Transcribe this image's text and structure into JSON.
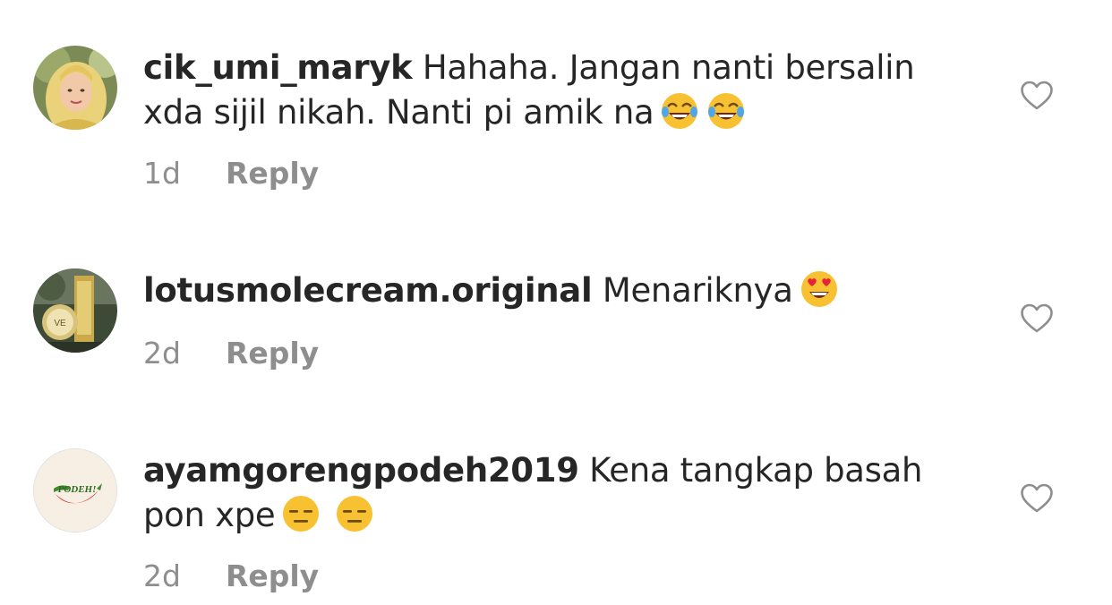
{
  "comments": [
    {
      "username": "cik_umi_maryk",
      "text_line1": " Hahaha. Jangan nanti bersalin",
      "text_line2": "xda sijil nikah. Nanti pi amik na",
      "emojis": [
        "face-with-tears-of-joy-emoji",
        "face-with-tears-of-joy-emoji"
      ],
      "time": "1d",
      "reply_label": "Reply",
      "avatar": "woman-hijab-avatar"
    },
    {
      "username": "lotusmolecream.original",
      "text_line1": " Menariknya",
      "emojis": [
        "heart-eyes-emoji"
      ],
      "time": "2d",
      "reply_label": "Reply",
      "avatar": "cream-product-avatar"
    },
    {
      "username": "ayamgorengpodeh2019",
      "text_line1": " Kena tangkap basah",
      "text_line2": "pon xpe",
      "emojis": [
        "expressionless-face-emoji",
        "expressionless-face-emoji"
      ],
      "time": "2d",
      "reply_label": "Reply",
      "avatar": "podeh-logo-avatar",
      "avatar_logo_text": "PODEH!"
    }
  ],
  "colors": {
    "text": "#262626",
    "meta": "#8e8e8e",
    "heart_outline": "#8e8e8e",
    "background": "#ffffff"
  },
  "icons": {
    "like": "heart-outline-icon"
  }
}
